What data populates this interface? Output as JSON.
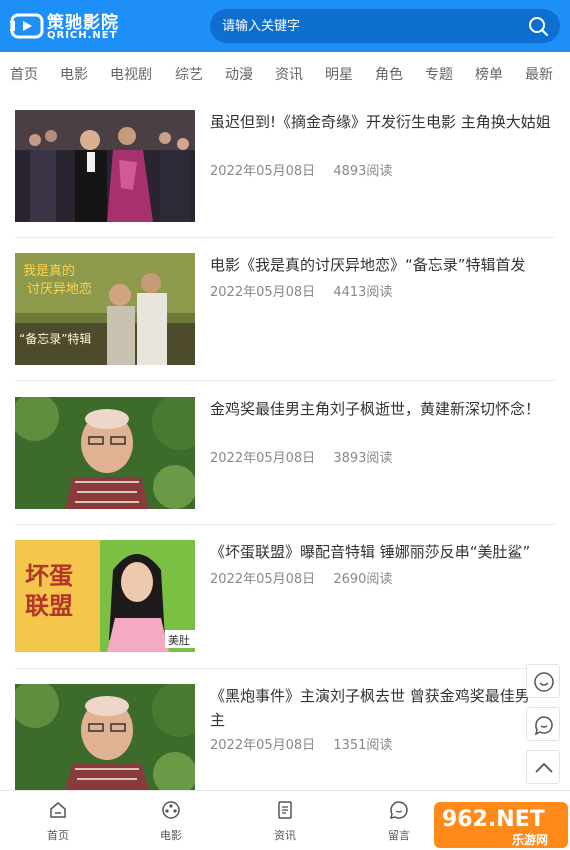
{
  "header": {
    "logo_cn": "策驰影院",
    "logo_en": "QRICH.NET",
    "search_placeholder": "请输入关键字",
    "brand_color": "#1e8ff7"
  },
  "nav": {
    "items": [
      "首页",
      "电影",
      "电视剧",
      "综艺",
      "动漫",
      "资讯",
      "明星",
      "角色",
      "专题",
      "榜单",
      "最新"
    ]
  },
  "articles": [
    {
      "title": "虽迟但到!《摘金奇缘》开发衍生电影 主角换大姑姐",
      "date": "2022年05月08日",
      "reads": "4893阅读"
    },
    {
      "title": "电影《我是真的讨厌异地恋》“备忘录”特辑首发",
      "date": "2022年05月08日",
      "reads": "4413阅读"
    },
    {
      "title": "金鸡奖最佳男主角刘子枫逝世，黄建新深切怀念！",
      "date": "2022年05月08日",
      "reads": "3893阅读"
    },
    {
      "title": "《坏蛋联盟》曝配音特辑 锤娜丽莎反串“美肚鲨”",
      "date": "2022年05月08日",
      "reads": "2690阅读"
    },
    {
      "title": "《黑炮事件》主演刘子枫去世 曾获金鸡奖最佳男主",
      "date": "2022年05月08日",
      "reads": "1351阅读"
    }
  ],
  "thumb_text": {
    "t2_line1": "我是真的",
    "t2_line2": "讨厌异地恋",
    "t2_tag": "“备忘录”特辑",
    "t4_line1": "坏蛋",
    "t4_line2": "联盟",
    "t4_tag": "美肚"
  },
  "bottom_tabs": [
    "首页",
    "电影",
    "资讯",
    "留言"
  ],
  "watermark": {
    "brand": "962.NET",
    "sub": "乐游网"
  }
}
